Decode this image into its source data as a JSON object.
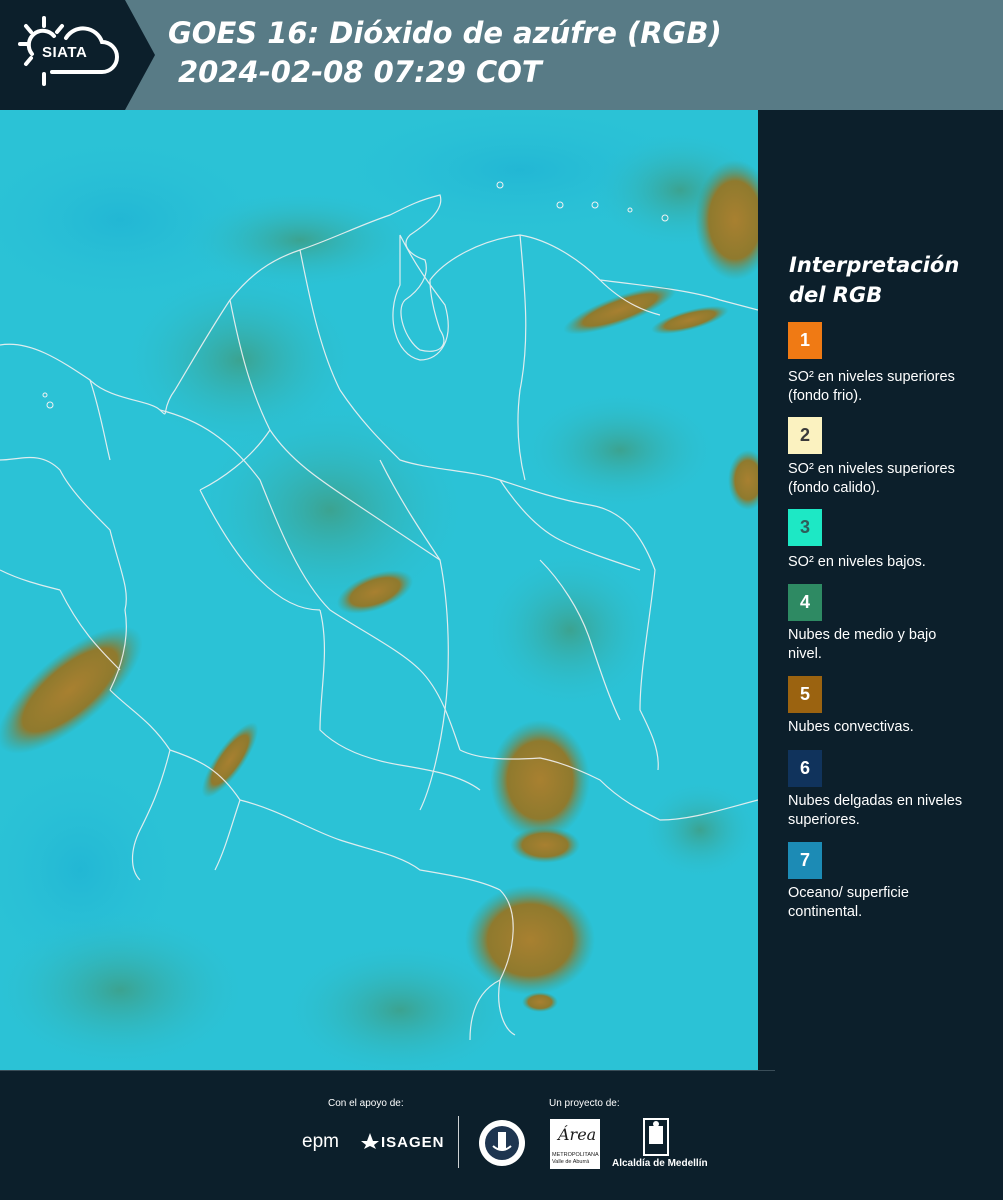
{
  "header": {
    "logo_text": "SIATA",
    "title_line1": "GOES 16: Dióxido de azúfre (RGB)",
    "title_line2": "2024-02-08 07:29 COT"
  },
  "legend": {
    "title": "Interpretación del RGB",
    "items": [
      {
        "number": "1",
        "color": "#f07a14",
        "text_color": "#ffffff",
        "label": "SO² en niveles superiores (fondo frio)."
      },
      {
        "number": "2",
        "color": "#fbf2c0",
        "text_color": "#3a3a3a",
        "label": "SO² en niveles superiores (fondo calido)."
      },
      {
        "number": "3",
        "color": "#1de8c5",
        "text_color": "#2e5d5a",
        "label": "SO² en niveles bajos."
      },
      {
        "number": "4",
        "color": "#2e8a63",
        "text_color": "#ffffff",
        "label": "Nubes de medio y bajo nivel."
      },
      {
        "number": "5",
        "color": "#9b6310",
        "text_color": "#ffffff",
        "label": "Nubes convectivas."
      },
      {
        "number": "6",
        "color": "#10335c",
        "text_color": "#ffffff",
        "label": "Nubes delgadas en niveles superiores."
      },
      {
        "number": "7",
        "color": "#1c8bb5",
        "text_color": "#ffffff",
        "label": "Oceano/ superficie continental."
      }
    ]
  },
  "footer": {
    "support_label": "Con el apoyo de:",
    "project_label": "Un proyecto de:",
    "sponsors": [
      "epm",
      "ISAGEN"
    ],
    "partners": [
      "Área Metropolitana Valle de Aburrá",
      "Alcaldía de Medellín"
    ],
    "metro_logo_letter": "Área",
    "metro_logo_sub": "METROPOLITANA Valle de Aburrá",
    "alcaldia_label": "Alcaldía de Medellín"
  },
  "map": {
    "background_color": "#2bc2d6",
    "convective_color": "#9b7a2c",
    "low_cloud_color": "#3c9a86",
    "border_color": "#f2f2f2"
  }
}
